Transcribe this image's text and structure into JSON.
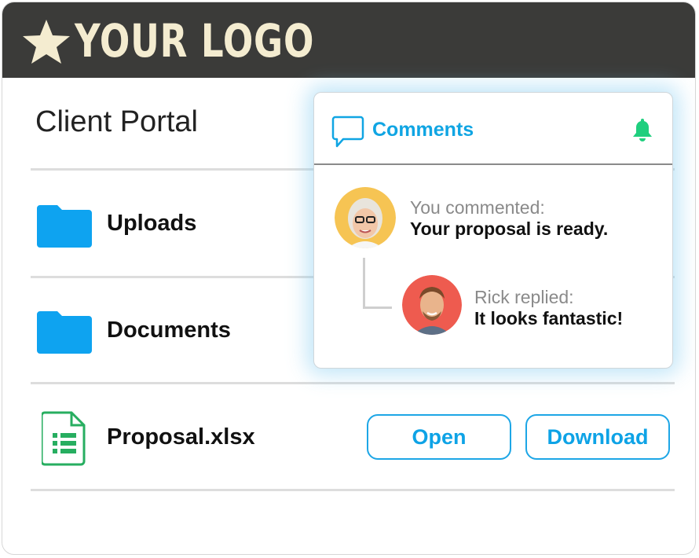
{
  "brand": {
    "logo_text": "YOUR LOGO",
    "star_color": "#f4ecd0",
    "bar_color": "#3b3b39"
  },
  "page": {
    "title": "Client Portal"
  },
  "rows": [
    {
      "label": "Uploads",
      "icon": "folder-icon"
    },
    {
      "label": "Documents",
      "icon": "folder-icon"
    },
    {
      "label": "Proposal.xlsx",
      "icon": "spreadsheet-file-icon"
    }
  ],
  "actions": {
    "open_label": "Open",
    "download_label": "Download",
    "accent": "#1da6e6"
  },
  "comments": {
    "title": "Comments",
    "thread": [
      {
        "meta": "You commented:",
        "text": "Your proposal is ready.",
        "avatar": "woman-avatar"
      },
      {
        "meta": "Rick replied:",
        "text": "It looks fantastic!",
        "avatar": "man-avatar"
      }
    ],
    "bell_color": "#1fcf7e"
  }
}
